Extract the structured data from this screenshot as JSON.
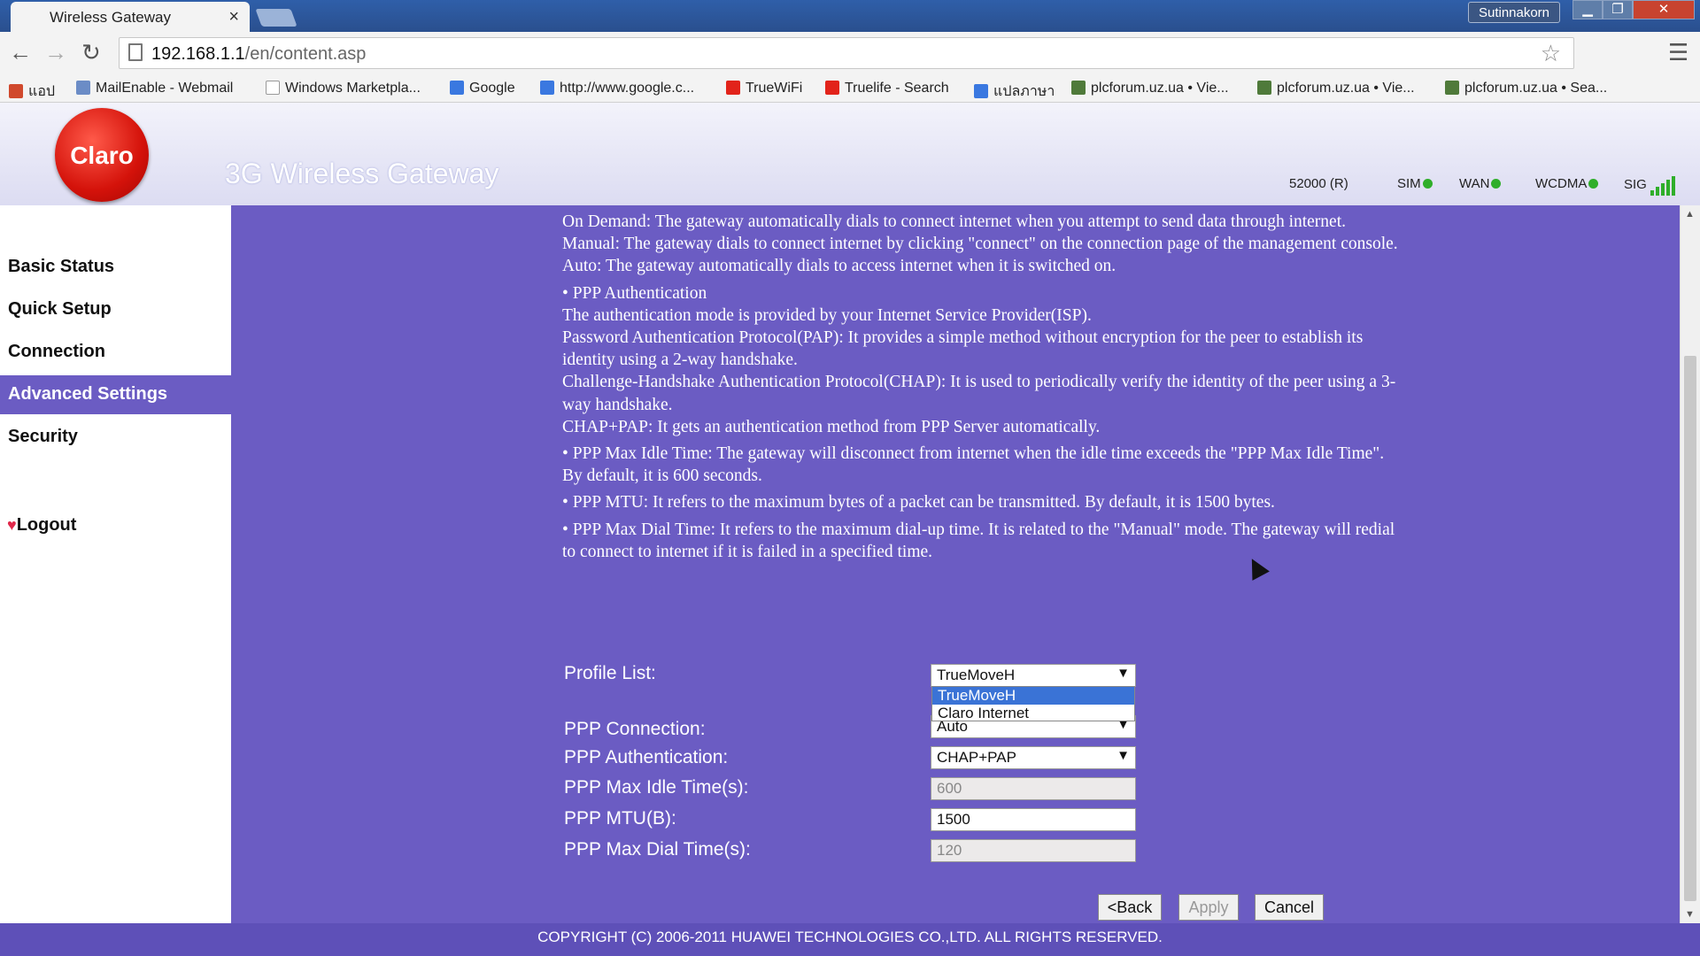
{
  "browser": {
    "tab_title": "Wireless Gateway",
    "tab_close": "×",
    "user_label": "Sutinnakorn",
    "win_min": "▁",
    "win_max": "❐",
    "win_close": "✕",
    "url_host": "192.168.1.1",
    "url_path": "/en/content.asp",
    "bookmarks": [
      {
        "label": "แอป",
        "icon": "apps-icon",
        "color": "#d0492d"
      },
      {
        "label": "MailEnable - Webmail",
        "icon": "mail-icon",
        "color": "#6b8cc6"
      },
      {
        "label": "Windows Marketpla...",
        "icon": "page-icon",
        "color": "#cccccc"
      },
      {
        "label": "Google",
        "icon": "google-icon",
        "color": "#3a78e0"
      },
      {
        "label": "http://www.google.c...",
        "icon": "google-icon",
        "color": "#3a78e0"
      },
      {
        "label": "TrueWiFi",
        "icon": "true-icon",
        "color": "#e2231a"
      },
      {
        "label": "Truelife - Search",
        "icon": "true-icon",
        "color": "#e2231a"
      },
      {
        "label": "แปลภาษา",
        "icon": "translate-icon",
        "color": "#3a78e0"
      },
      {
        "label": "plcforum.uz.ua • Vie...",
        "icon": "forum-icon",
        "color": "#4f7a3a"
      },
      {
        "label": "plcforum.uz.ua • Vie...",
        "icon": "forum-icon",
        "color": "#4f7a3a"
      },
      {
        "label": "plcforum.uz.ua • Sea...",
        "icon": "forum-icon",
        "color": "#4f7a3a"
      }
    ]
  },
  "header": {
    "logo_text": "Claro",
    "title": "3G Wireless Gateway",
    "status_freq": "52000 (R)",
    "sim": "SIM",
    "wan": "WAN",
    "wcdma": "WCDMA",
    "sig": "SIG",
    "status_color": "#2fae2a"
  },
  "sidebar": {
    "items": [
      {
        "label": "Basic Status"
      },
      {
        "label": "Quick Setup"
      },
      {
        "label": "Connection"
      },
      {
        "label": "Advanced Settings"
      },
      {
        "label": "Security"
      }
    ],
    "logout": "Logout",
    "active_color": "#6b5cc3"
  },
  "help": {
    "l1": "On Demand: The gateway automatically dials to connect internet when you attempt to send data through internet.",
    "l2": "Manual: The gateway dials to connect internet by clicking \"connect\" on the connection page of the management console.",
    "l3": "Auto: The gateway automatically dials to access internet when it is switched on.",
    "h_auth": "• PPP Authentication",
    "l4": "The authentication mode is provided by your Internet Service Provider(ISP).",
    "l5": "Password Authentication Protocol(PAP): It provides a simple method without encryption for the peer to establish its identity using a 2-way handshake.",
    "l6": "Challenge-Handshake Authentication Protocol(CHAP): It is used to periodically verify the identity of the peer using a 3-way handshake.",
    "l7": "CHAP+PAP: It gets an authentication method from PPP Server automatically.",
    "l8": "• PPP Max Idle Time: The gateway will disconnect from internet when the idle time exceeds the \"PPP Max Idle Time\". By default, it is 600 seconds.",
    "l9": "• PPP MTU: It refers to the maximum bytes of a packet can be transmitted. By default, it is 1500 bytes.",
    "l10": "• PPP Max Dial Time: It refers to the maximum dial-up time. It is related to the \"Manual\" mode. The gateway will redial to connect to internet if it is failed in a specified time."
  },
  "form": {
    "profile_label": "Profile List:",
    "profile_value": "TrueMoveH",
    "profile_options": [
      "TrueMoveH",
      "Claro Internet"
    ],
    "connection_label": "PPP Connection:",
    "connection_value": "Auto",
    "auth_label": "PPP Authentication:",
    "auth_value": "CHAP+PAP",
    "idle_label": "PPP Max Idle Time(s):",
    "idle_value": "600",
    "mtu_label": "PPP MTU(B):",
    "mtu_value": "1500",
    "dial_label": "PPP Max Dial Time(s):",
    "dial_value": "120",
    "caret": "▼"
  },
  "buttons": {
    "back": "<Back",
    "apply": "Apply",
    "cancel": "Cancel"
  },
  "footer": "COPYRIGHT (C) 2006-2011 HUAWEI TECHNOLOGIES CO.,LTD. ALL RIGHTS RESERVED."
}
